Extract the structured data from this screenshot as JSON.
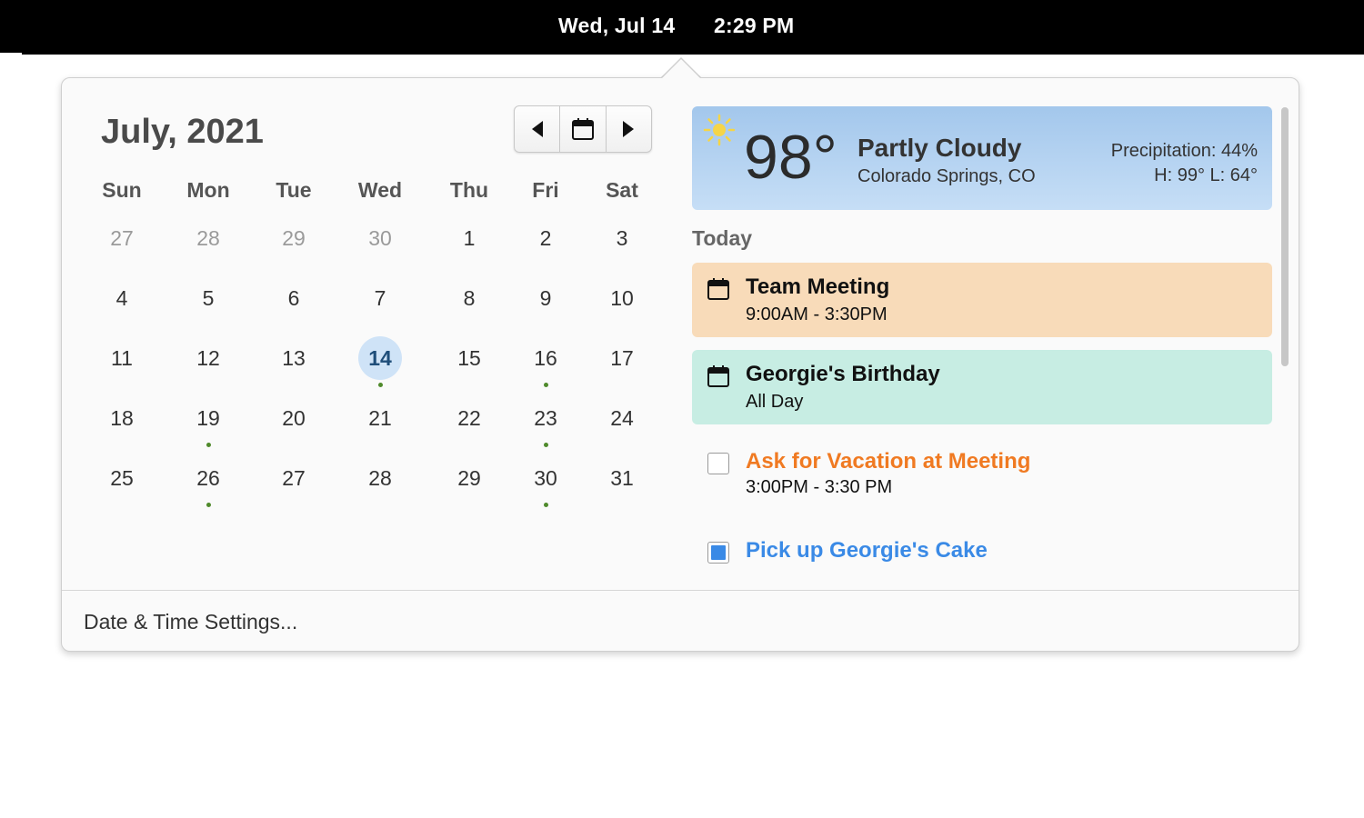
{
  "topbar": {
    "date": "Wed, Jul 14",
    "time": "2:29 PM"
  },
  "calendar": {
    "month_title": "July, 2021",
    "weekdays": [
      "Sun",
      "Mon",
      "Tue",
      "Wed",
      "Thu",
      "Fri",
      "Sat"
    ],
    "weeks": [
      [
        "27",
        "28",
        "29",
        "30",
        "1",
        "2",
        "3"
      ],
      [
        "4",
        "5",
        "6",
        "7",
        "8",
        "9",
        "10"
      ],
      [
        "11",
        "12",
        "13",
        "14",
        "15",
        "16",
        "17"
      ],
      [
        "18",
        "19",
        "20",
        "21",
        "22",
        "23",
        "24"
      ],
      [
        "25",
        "26",
        "27",
        "28",
        "29",
        "30",
        "31"
      ]
    ],
    "today": "14",
    "dot_color": "#4f8a2b",
    "today_color": "#cfe3f7",
    "nav": {
      "prev_icon": "chevron-left-icon",
      "today_icon": "calendar-icon",
      "next_icon": "chevron-right-icon"
    }
  },
  "weather": {
    "icon": "sun-icon",
    "temperature": "98°",
    "condition": "Partly Cloudy",
    "location": "Colorado Springs, CO",
    "precipitation": "Precipitation: 44%",
    "high_low": "H: 99°  L: 64°"
  },
  "agenda": {
    "section_label": "Today",
    "events": [
      {
        "title": "Team Meeting",
        "time": "9:00AM - 3:30PM",
        "color": "#f8dbb9",
        "icon": "calendar-icon"
      },
      {
        "title": "Georgie's Birthday",
        "time": "All Day",
        "color": "#c7ede3",
        "icon": "calendar-icon"
      }
    ],
    "tasks": [
      {
        "title": "Ask for Vacation at Meeting",
        "time": "3:00PM - 3:30 PM",
        "checked": false,
        "color": "#f07a22"
      },
      {
        "title": "Pick up Georgie's Cake",
        "checked": true,
        "color": "#3a8ae6"
      }
    ]
  },
  "footer": {
    "settings_label": "Date & Time Settings..."
  }
}
